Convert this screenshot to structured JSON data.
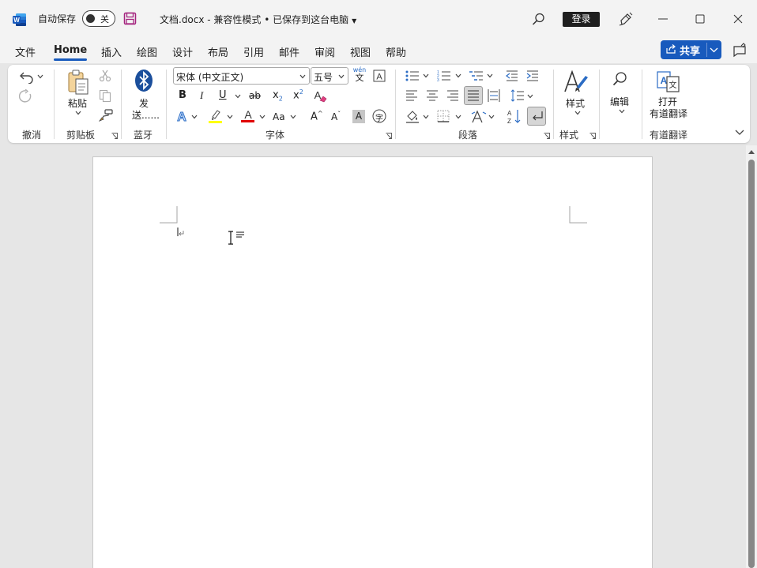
{
  "titlebar": {
    "autosave_label": "自动保存",
    "autosave_state": "关",
    "document_title": "文档.docx  -  兼容性模式 • 已保存到这台电脑",
    "login_label": "登录"
  },
  "menu": {
    "tabs": [
      "文件",
      "Home",
      "插入",
      "绘图",
      "设计",
      "布局",
      "引用",
      "邮件",
      "审阅",
      "视图",
      "帮助"
    ],
    "active_tab": "Home",
    "share_label": "共享"
  },
  "ribbon": {
    "undo_group": "撤消",
    "clipboard": {
      "paste_label": "粘贴",
      "group": "剪贴板"
    },
    "bluetooth": {
      "send_label_1": "发",
      "send_label_2": "送......",
      "group": "蓝牙"
    },
    "font": {
      "font_name": "宋体 (中文正文)",
      "font_size": "五号",
      "phonetic_top": "wén",
      "phonetic_bottom": "文",
      "bold": "B",
      "italic": "I",
      "underline": "U",
      "strike": "ab",
      "subscript": "x",
      "superscript": "x",
      "change_case": "Aa",
      "grow": "A",
      "shrink": "A",
      "shade": "A",
      "enclose": "字",
      "group": "字体"
    },
    "paragraph": {
      "group": "段落"
    },
    "styles": {
      "label": "样式",
      "group": "样式"
    },
    "editing": {
      "label": "编辑"
    },
    "youdao": {
      "label_1": "打开",
      "label_2": "有道翻译",
      "group": "有道翻译"
    }
  },
  "colors": {
    "accent": "#185abd",
    "highlight": "#ffff00",
    "font_color": "#e00000"
  }
}
